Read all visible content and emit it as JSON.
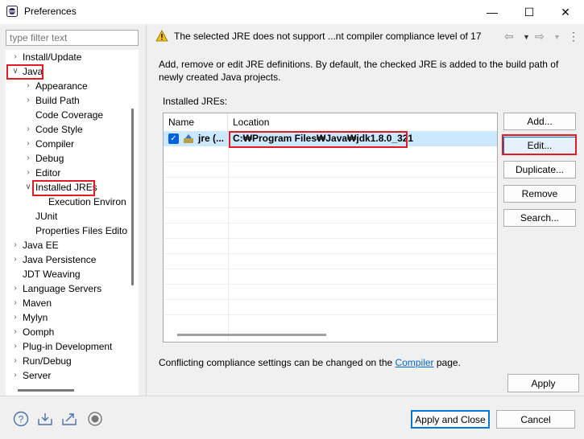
{
  "window": {
    "title": "Preferences",
    "minimize_glyph": "—",
    "maximize_glyph": "☐",
    "close_glyph": "✕"
  },
  "sidebar": {
    "filter_placeholder": "type filter text",
    "tree": [
      {
        "label": "Install/Update",
        "twisty": "›"
      },
      {
        "label": "Java",
        "twisty": "∨"
      },
      {
        "label": "Appearance",
        "twisty": "›"
      },
      {
        "label": "Build Path",
        "twisty": "›"
      },
      {
        "label": "Code Coverage",
        "twisty": ""
      },
      {
        "label": "Code Style",
        "twisty": "›"
      },
      {
        "label": "Compiler",
        "twisty": "›"
      },
      {
        "label": "Debug",
        "twisty": "›"
      },
      {
        "label": "Editor",
        "twisty": "›"
      },
      {
        "label": "Installed JREs",
        "twisty": "∨"
      },
      {
        "label": "Execution Environ",
        "twisty": ""
      },
      {
        "label": "JUnit",
        "twisty": ""
      },
      {
        "label": "Properties Files Edito",
        "twisty": ""
      },
      {
        "label": "Java EE",
        "twisty": "›"
      },
      {
        "label": "Java Persistence",
        "twisty": "›"
      },
      {
        "label": "JDT Weaving",
        "twisty": ""
      },
      {
        "label": "Language Servers",
        "twisty": "›"
      },
      {
        "label": "Maven",
        "twisty": "›"
      },
      {
        "label": "Mylyn",
        "twisty": "›"
      },
      {
        "label": "Oomph",
        "twisty": "›"
      },
      {
        "label": "Plug-in Development",
        "twisty": "›"
      },
      {
        "label": "Run/Debug",
        "twisty": "›"
      },
      {
        "label": "Server",
        "twisty": "›"
      }
    ]
  },
  "page": {
    "warning": "The selected JRE does not support ...nt compiler compliance level of 17",
    "description": "Add, remove or edit JRE definitions. By default, the checked JRE is added to the build path of newly created Java projects.",
    "installed_label": "Installed JREs:",
    "columns": [
      "Name",
      "Location"
    ],
    "jre": {
      "name": "jre (...",
      "location": "C:₩Program Files₩Java₩jdk1.8.0_321",
      "checked": true
    },
    "buttons": {
      "add": "Add...",
      "edit": "Edit...",
      "duplicate": "Duplicate...",
      "remove": "Remove",
      "search": "Search..."
    },
    "conflict_before": "Conflicting compliance settings can be changed on the ",
    "conflict_link": "Compiler",
    "conflict_after": " page.",
    "apply": "Apply"
  },
  "footer": {
    "apply_close": "Apply and Close",
    "cancel": "Cancel",
    "icons": [
      "help-icon",
      "import-icon",
      "export-icon",
      "record-icon"
    ]
  },
  "colors": {
    "highlight": "#e01b24",
    "selection": "#cce8ff",
    "link": "#0066cc"
  }
}
